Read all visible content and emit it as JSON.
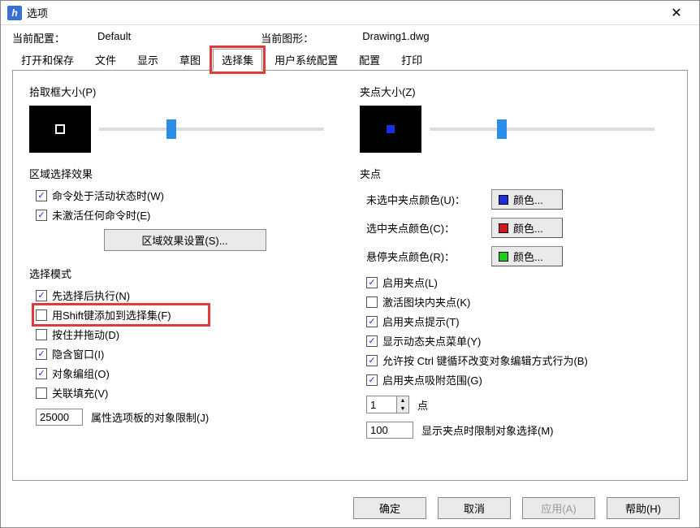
{
  "title": "选项",
  "config": {
    "label": "当前配置：",
    "value": "Default",
    "drawing_label": "当前图形：",
    "drawing_value": "Drawing1.dwg"
  },
  "tabs": [
    "打开和保存",
    "文件",
    "显示",
    "草图",
    "选择集",
    "用户系统配置",
    "配置",
    "打印"
  ],
  "active_tab": "选择集",
  "left": {
    "pickbox_label": "拾取框大小(P)",
    "area_title": "区域选择效果",
    "area_chk1": "命令处于活动状态时(W)",
    "area_chk2": "未激活任何命令时(E)",
    "area_btn": "区域效果设置(S)...",
    "mode_title": "选择模式",
    "mode_chk1": "先选择后执行(N)",
    "mode_chk2": "用Shift键添加到选择集(F)",
    "mode_chk3": "按住并拖动(D)",
    "mode_chk4": "隐含窗口(I)",
    "mode_chk5": "对象编组(O)",
    "mode_chk6": "关联填充(V)",
    "limit_value": "25000",
    "limit_label": "属性选项板的对象限制(J)"
  },
  "right": {
    "grip_label": "夹点大小(Z)",
    "grip_title": "夹点",
    "color1_label": "未选中夹点颜色(U)：",
    "color2_label": "选中夹点颜色(C)：",
    "color3_label": "悬停夹点颜色(R)：",
    "color_btn": "颜色...",
    "color1": "#1a2ee0",
    "color2": "#d01818",
    "color3": "#18d018",
    "chk1": "启用夹点(L)",
    "chk2": "激活图块内夹点(K)",
    "chk3": "启用夹点提示(T)",
    "chk4": "显示动态夹点菜单(Y)",
    "chk5": "允许按 Ctrl 键循环改变对象编辑方式行为(B)",
    "chk6": "启用夹点吸附范围(G)",
    "spin_value": "1",
    "spin_label": "点",
    "limit_value": "100",
    "limit_label": "显示夹点时限制对象选择(M)"
  },
  "footer": {
    "ok": "确定",
    "cancel": "取消",
    "apply": "应用(A)",
    "help": "帮助(H)"
  }
}
